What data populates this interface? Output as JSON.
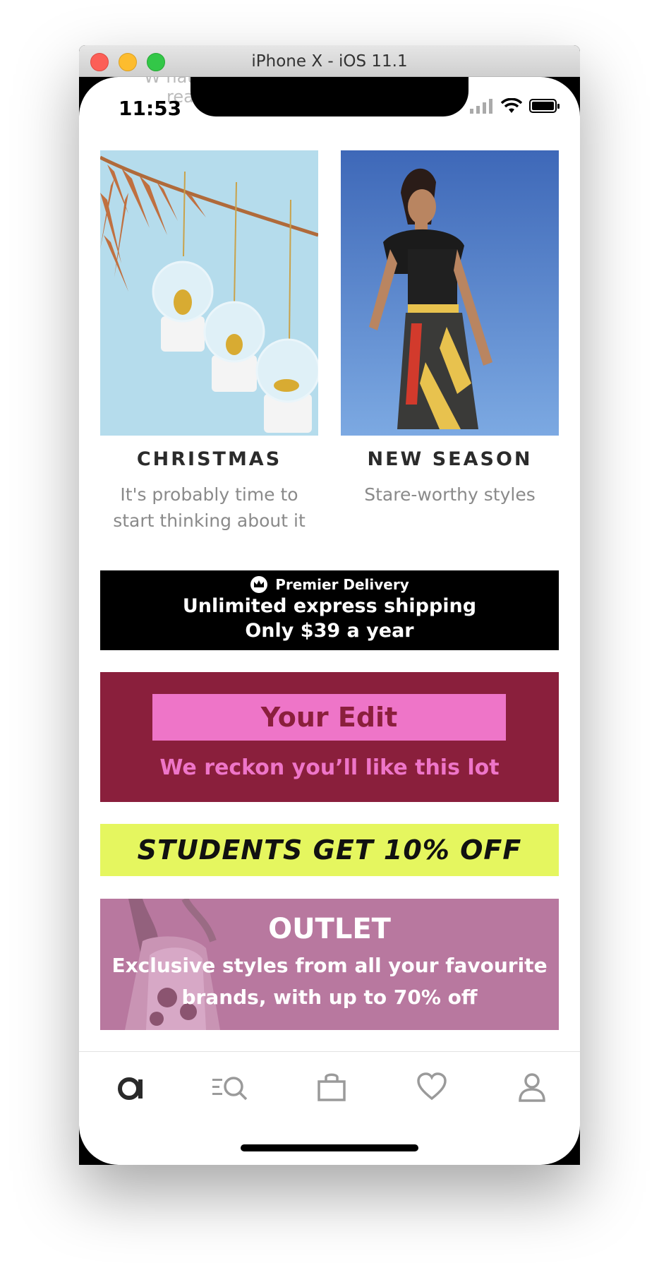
{
  "window": {
    "title": "iPhone X - iOS 11.1"
  },
  "status": {
    "time": "11:53"
  },
  "ghost_text": {
    "line1": "W hat",
    "line2": "real"
  },
  "tiles": [
    {
      "title": "CHRISTMAS",
      "subtitle": "It's probably time to start thinking about it",
      "icon": "snow-globe-ornaments-image"
    },
    {
      "title": "NEW SEASON",
      "subtitle": "Stare-worthy styles",
      "icon": "fashion-model-image"
    }
  ],
  "premier": {
    "label": "Premier Delivery",
    "line1": "Unlimited express shipping",
    "line2": "Only $39 a year"
  },
  "your_edit": {
    "button": "Your Edit",
    "tagline": "We reckon you’ll like this lot"
  },
  "students": {
    "text": "STUDENTS GET 10% OFF"
  },
  "outlet": {
    "title": "OUTLET",
    "subtitle_line1": "Exclusive styles from all your favourite",
    "subtitle_line2": "brands, with up to 70% off"
  },
  "tabbar": [
    "home-icon",
    "search-icon",
    "bag-icon",
    "heart-icon",
    "account-icon"
  ],
  "colors": {
    "edit_bg": "#8a1f3c",
    "edit_pink": "#ee75c8",
    "students_bg": "#e5f65f",
    "outlet_bg": "#b8789f"
  }
}
